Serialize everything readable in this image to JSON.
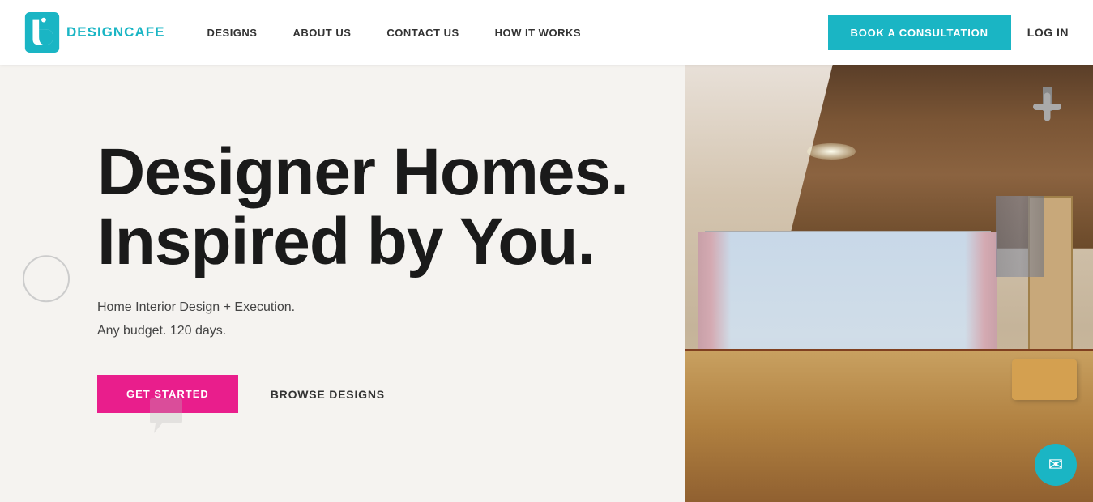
{
  "brand": {
    "name": "DESIGNCAFE",
    "logo_alt": "DesignCafe logo"
  },
  "navbar": {
    "links": [
      {
        "id": "designs",
        "label": "DESIGNS"
      },
      {
        "id": "about",
        "label": "ABOUT US"
      },
      {
        "id": "contact",
        "label": "CONTACT US"
      },
      {
        "id": "how",
        "label": "HOW IT WORKS"
      }
    ],
    "book_btn": "BOOK A CONSULTATION",
    "login": "LOG IN"
  },
  "hero": {
    "title_line1": "Designer Homes.",
    "title_line2": "Inspired by You.",
    "subtitle_line1": "Home Interior Design + Execution.",
    "subtitle_line2": "Any budget. 120 days.",
    "cta_primary": "GET STARTED",
    "cta_secondary": "BROWSE DESIGNS"
  },
  "chat": {
    "icon": "✉"
  }
}
